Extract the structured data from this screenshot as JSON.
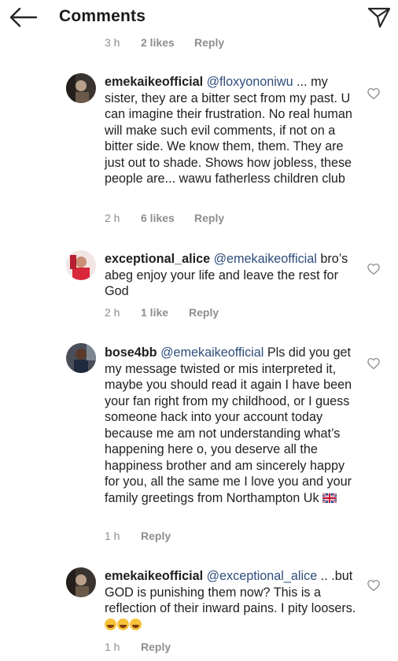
{
  "header": {
    "title": "Comments",
    "back_icon": "arrow-left-icon",
    "send_icon": "paper-plane-icon"
  },
  "top_meta": {
    "time": "3 h",
    "likes": "2 likes",
    "reply": "Reply"
  },
  "comments": [
    {
      "user": "emekaikeofficial",
      "mention": "@floxyononiwu",
      "text": " ... my sister, they are a bitter sect from my past. U can imagine their frustration. No real human will make such evil comments,  if not on a bitter side. We know them, them. They are just out to shade. Shows how jobless, these people are... wawu fatherless children club",
      "time": "2 h",
      "likes": "6 likes",
      "reply": "Reply"
    },
    {
      "user": "exceptional_alice",
      "mention": "@emekaikeofficial",
      "text": " bro’s abeg enjoy your life and leave the rest for God",
      "time": "2 h",
      "likes": "1 like",
      "reply": "Reply"
    },
    {
      "user": "bose4bb",
      "mention": "@emekaikeofficial",
      "text": " Pls did you get my message twisted or mis interpreted it, maybe you should read it again I have been your fan right from my childhood, or I guess someone hack into your account today because me am not understanding what’s happening here o, you deserve all the happiness brother and am sincerely happy for you, all the same me I love you and your family greetings from Northampton Uk",
      "time": "1 h",
      "reply": "Reply"
    },
    {
      "user": "emekaikeofficial",
      "mention": "@exceptional_alice",
      "text": " .. .but GOD is punishing them now? This is a reflection of their inward pains. I pity loosers.",
      "time": "1 h",
      "reply": "Reply"
    }
  ],
  "icons": {
    "heart": "heart-outline-icon",
    "flag": "uk-flag-icon",
    "emoji": "grinning-face-icon"
  },
  "colors": {
    "mention": "#2f4d7c",
    "meta": "#8e8e8e",
    "text": "#1f1f1f"
  }
}
